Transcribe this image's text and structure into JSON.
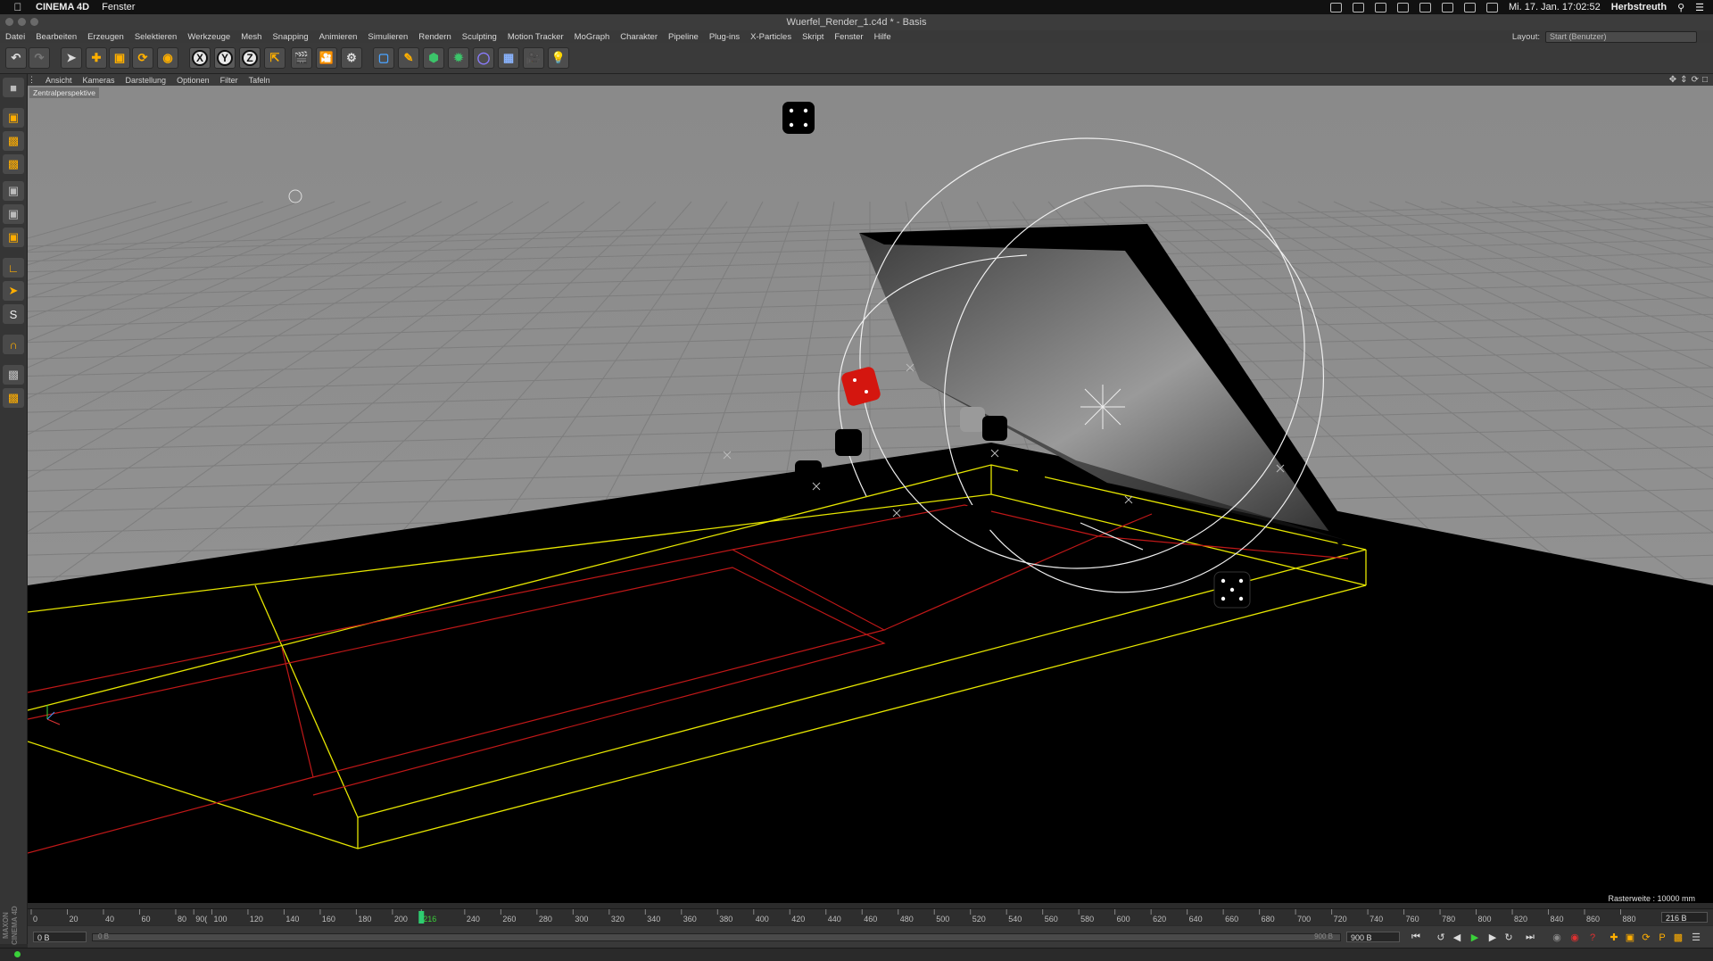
{
  "mac_menubar": {
    "app_name": "CINEMA 4D",
    "menu": "Fenster",
    "datetime": "Mi. 17. Jan.  17:02:52",
    "user": "Herbstreuth"
  },
  "window": {
    "title": "Wuerfel_Render_1.c4d * - Basis"
  },
  "menubar": {
    "items": [
      "Datei",
      "Bearbeiten",
      "Erzeugen",
      "Selektieren",
      "Werkzeuge",
      "Mesh",
      "Snapping",
      "Animieren",
      "Simulieren",
      "Rendern",
      "Sculpting",
      "Motion Tracker",
      "MoGraph",
      "Charakter",
      "Pipeline",
      "Plug-ins",
      "X-Particles",
      "Skript",
      "Fenster",
      "Hilfe"
    ],
    "layout_label": "Layout:",
    "layout_value": "Start (Benutzer)"
  },
  "toolbar": {
    "axis_x": "X",
    "axis_y": "Y",
    "axis_z": "Z"
  },
  "viewport_menu": {
    "items": [
      "Ansicht",
      "Kameras",
      "Darstellung",
      "Optionen",
      "Filter",
      "Tafeln"
    ]
  },
  "viewport": {
    "label": "Zentralperspektive",
    "raster": "Rasterweite : 10000 mm"
  },
  "timeline": {
    "ticks": [
      "0",
      "20",
      "40",
      "60",
      "80",
      "100",
      "120",
      "140",
      "160",
      "180",
      "200",
      "216",
      "240",
      "260",
      "280",
      "300",
      "320",
      "340",
      "360",
      "380",
      "400",
      "420",
      "440",
      "460",
      "480",
      "500",
      "520",
      "540",
      "560",
      "580",
      "600",
      "620",
      "640",
      "660",
      "680",
      "700",
      "720",
      "740",
      "760",
      "780",
      "800",
      "820",
      "840",
      "860",
      "880",
      "90("
    ],
    "current_frame": "216 B",
    "playhead": 216,
    "max": 900
  },
  "transport": {
    "start_field": "0 B",
    "range_start": "0 B",
    "range_end": "900 B",
    "end_field": "900 B"
  },
  "branding": {
    "text": "MAXON CINEMA 4D"
  },
  "colors": {
    "accent": "#ffae00",
    "playhead": "#2ecc71",
    "selection_yellow": "#e6e600",
    "wire_red": "#c01818"
  }
}
